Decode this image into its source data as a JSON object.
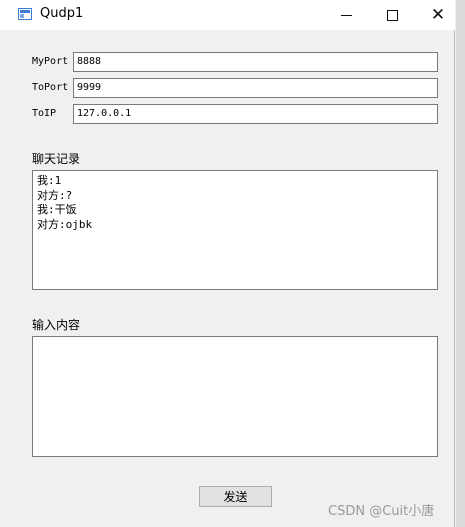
{
  "window": {
    "title": "Qudp1",
    "close_glyph": "✕",
    "icon_names": [
      "app-window-icon",
      "minimize-icon",
      "maximize-icon",
      "close-icon"
    ]
  },
  "form": {
    "myport_label": "MyPort",
    "myport_value": "8888",
    "toport_label": "ToPort",
    "toport_value": "9999",
    "toip_label": "ToIP",
    "toip_value": "127.0.0.1"
  },
  "chat": {
    "label": "聊天记录",
    "lines": [
      "我:1",
      "对方:?",
      "我:干饭",
      "对方:ojbk"
    ]
  },
  "input": {
    "label": "输入内容",
    "value": ""
  },
  "send_button": "发送",
  "watermark": "CSDN @Cuit小唐"
}
